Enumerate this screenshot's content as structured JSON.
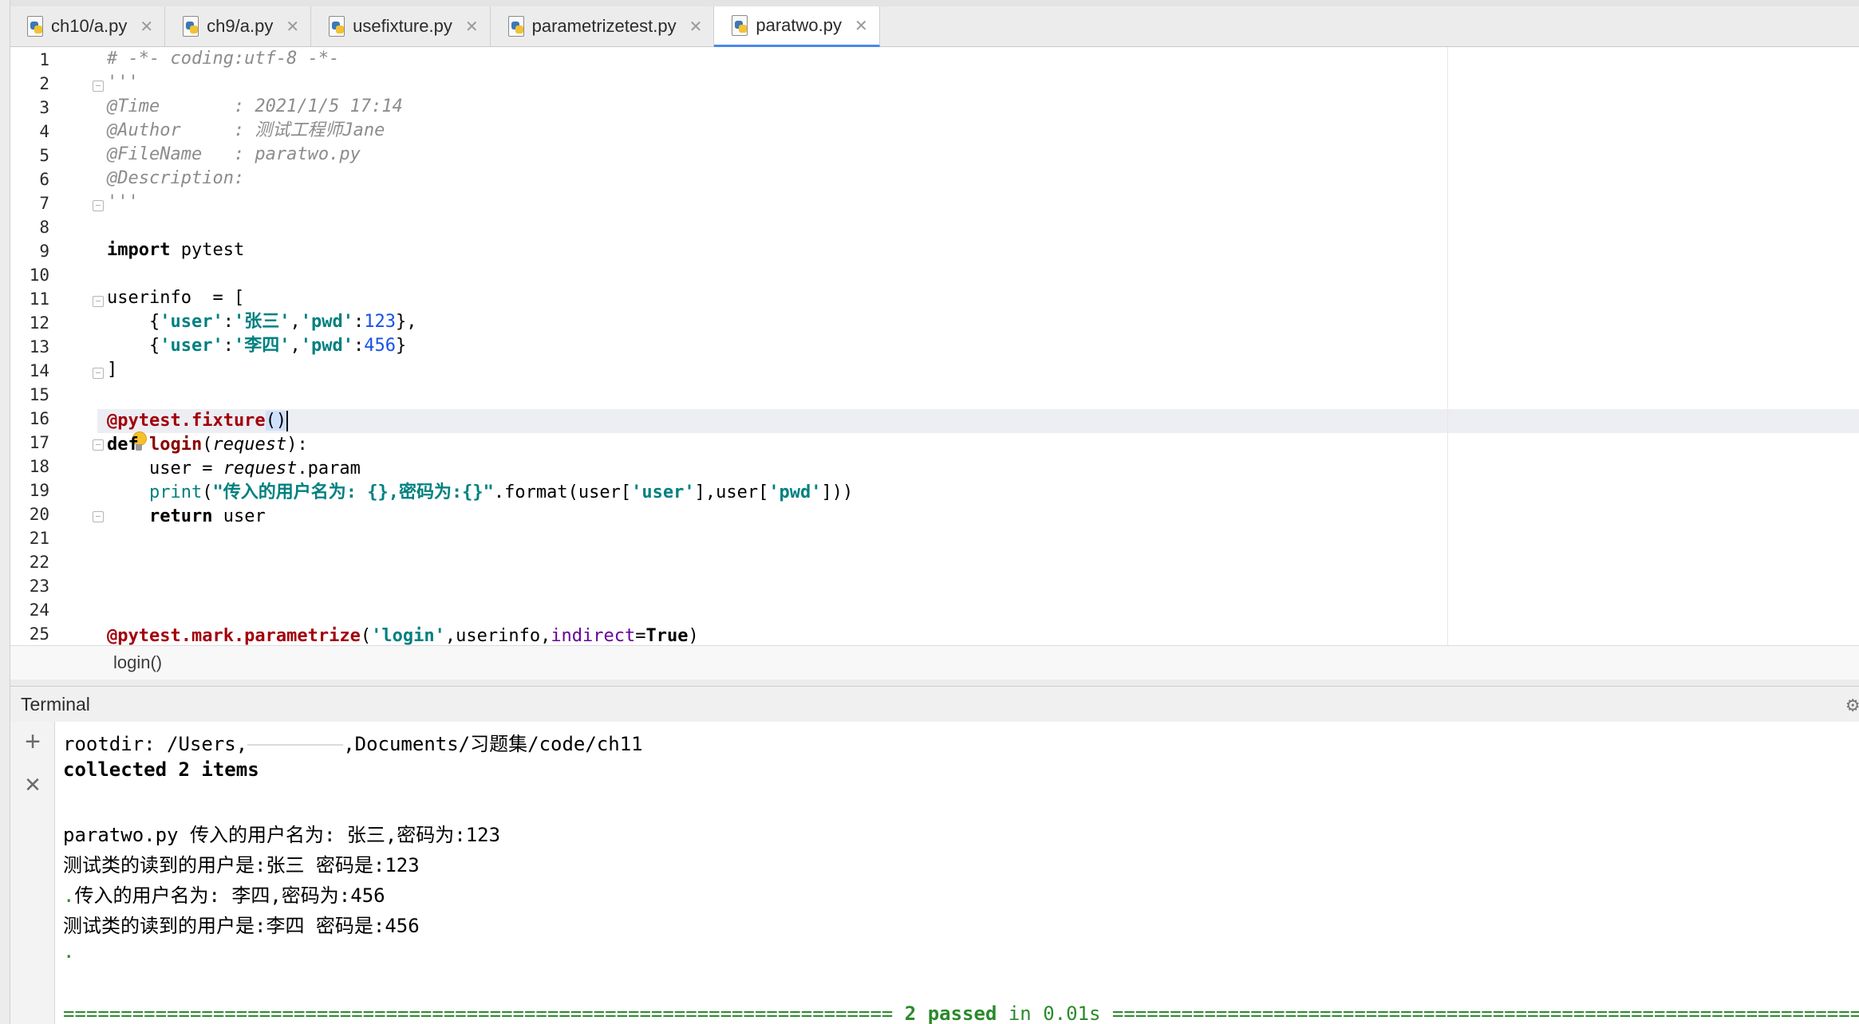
{
  "tabs": [
    {
      "label": "ch10/a.py",
      "active": false
    },
    {
      "label": "ch9/a.py",
      "active": false
    },
    {
      "label": "usefixture.py",
      "active": false
    },
    {
      "label": "parametrizetest.py",
      "active": false
    },
    {
      "label": "paratwo.py",
      "active": true
    }
  ],
  "editor": {
    "line_numbers": [
      "1",
      "2",
      "3",
      "4",
      "5",
      "6",
      "7",
      "8",
      "9",
      "10",
      "11",
      "12",
      "13",
      "14",
      "15",
      "16",
      "17",
      "18",
      "19",
      "20",
      "21",
      "22",
      "23",
      "24",
      "25"
    ],
    "code": {
      "l1": "# -*- coding:utf-8 -*-",
      "l2": "'''",
      "l3": "@Time       : 2021/1/5 17:14",
      "l4": "@Author     : 测试工程师Jane",
      "l5": "@FileName   : paratwo.py",
      "l6": "@Description:",
      "l7": "'''",
      "l9_kw": "import",
      "l9_rest": " pytest",
      "l11": "userinfo  = [",
      "l12_a": "    {",
      "l12_k1": "'user'",
      "l12_c": ":",
      "l12_v1": "'张三'",
      "l12_d": ",",
      "l12_k2": "'pwd'",
      "l12_e": ":",
      "l12_n": "123",
      "l12_f": "},",
      "l13_a": "    {",
      "l13_k1": "'user'",
      "l13_c": ":",
      "l13_v1": "'李四'",
      "l13_d": ",",
      "l13_k2": "'pwd'",
      "l13_e": ":",
      "l13_n": "456",
      "l13_f": "}",
      "l14": "]",
      "l16_dec": "@pytest.fixture",
      "l16_paren": "()",
      "l17_kw": "def",
      "l17_fn": "login",
      "l17_p1": "(",
      "l17_param": "request",
      "l17_p2": "):",
      "l18_a": "    user = ",
      "l18_param": "request",
      "l18_b": ".param",
      "l19_ind": "    ",
      "l19_bi": "print",
      "l19_p": "(",
      "l19_str": "\"传入的用户名为: {},密码为:{}\"",
      "l19_b": ".format(user[",
      "l19_k1": "'user'",
      "l19_c": "],user[",
      "l19_k2": "'pwd'",
      "l19_d": "]))",
      "l20_ind": "    ",
      "l20_kw": "return",
      "l20_rest": " user",
      "l25_dec": "@pytest.mark.parametrize",
      "l25_p": "(",
      "l25_str": "'login'",
      "l25_b": ",userinfo,",
      "l25_kwarg": "indirect",
      "l25_eq": "=",
      "l25_true": "True",
      "l25_e": ")"
    }
  },
  "breadcrumb": "login()",
  "terminal": {
    "title": "Terminal",
    "add_label": "+",
    "close_label": "✕",
    "gear": "⚙",
    "line1_a": "rootdir: /Users,",
    "line1_b": ",Documents/习题集/code/ch11",
    "line2": "collected 2 items",
    "line4": "paratwo.py 传入的用户名为: 张三,密码为:123",
    "line5": "测试类的读到的用户是:张三 密码是:123",
    "line6_dot": ".",
    "line6_rest": "传入的用户名为: 李四,密码为:456",
    "line7": "测试类的读到的用户是:李四 密码是:456",
    "line8": ".",
    "passed_left": "========================================================================",
    "passed_bold": " 2 passed",
    "passed_mid": " in 0.01s ",
    "passed_right": "========================================================================"
  }
}
